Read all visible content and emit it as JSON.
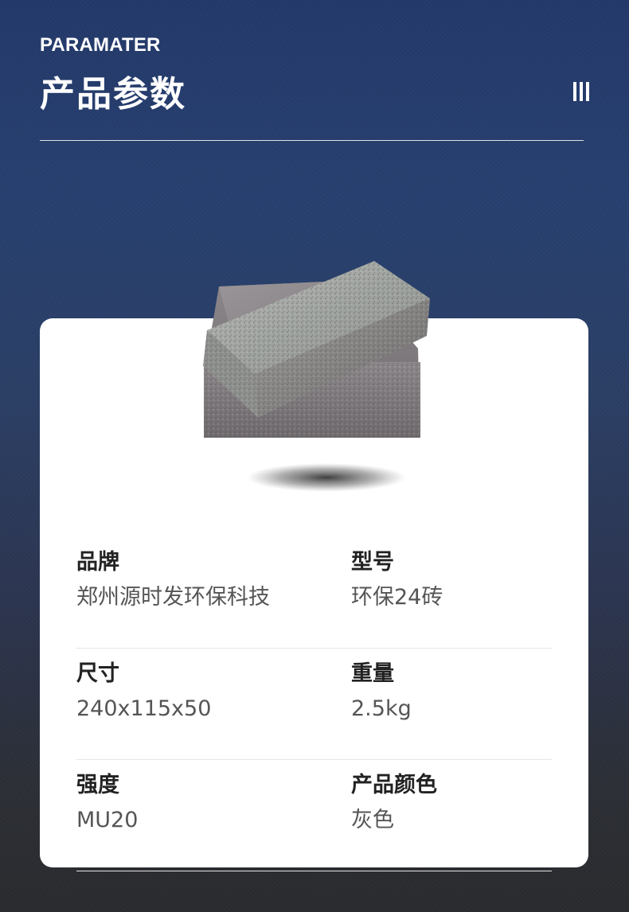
{
  "header": {
    "subtitle": "PARAMATER",
    "title": "产品参数",
    "menu_icon": "vertical-bars-icon"
  },
  "product": {
    "image": "stacked-gray-brick-image"
  },
  "params": [
    {
      "left": {
        "label": "品牌",
        "value": "郑州源时发环保科技"
      },
      "right": {
        "label": "型号",
        "value": "环保24砖"
      }
    },
    {
      "left": {
        "label": "尺寸",
        "value": "240x115x50"
      },
      "right": {
        "label": "重量",
        "value": "2.5kg"
      }
    },
    {
      "left": {
        "label": "强度",
        "value": "MU20"
      },
      "right": {
        "label": "产品颜色",
        "value": "灰色"
      }
    }
  ],
  "colors": {
    "background_top": "#23396a",
    "background_bottom": "#2a2b2e",
    "card": "#ffffff",
    "label": "#222222",
    "value": "#555555"
  }
}
